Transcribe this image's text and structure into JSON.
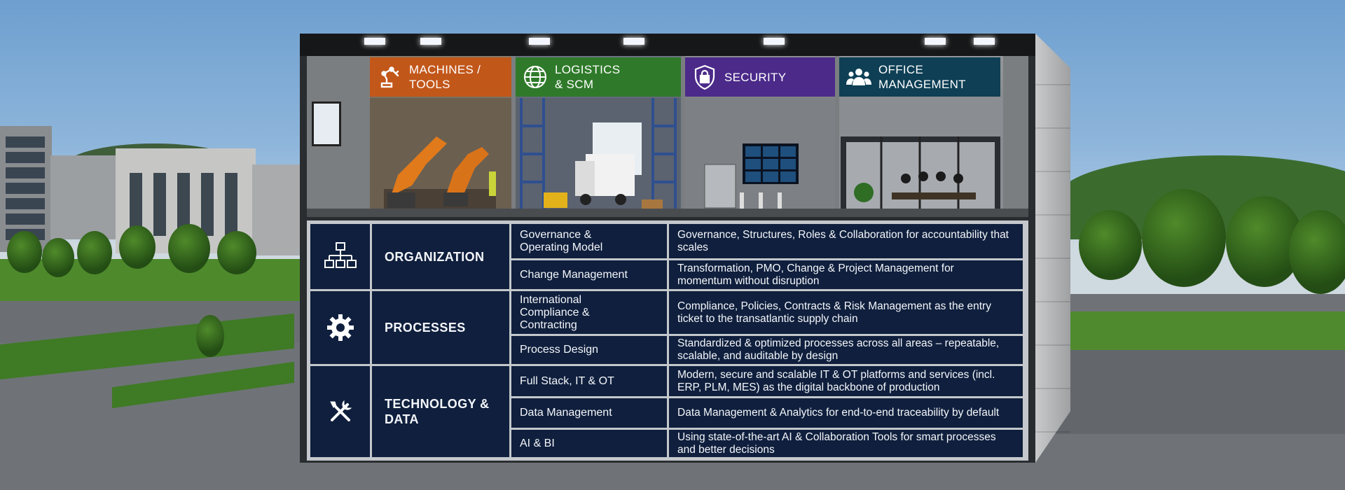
{
  "categories": [
    {
      "label": "MACHINES /\nTOOLS",
      "icon": "robot-arm-icon",
      "color": "#c2571a"
    },
    {
      "label": "LOGISTICS\n& SCM",
      "icon": "globe-icon",
      "color": "#2f7a2a"
    },
    {
      "label": "SECURITY",
      "icon": "shield-lock-icon",
      "color": "#4b2a8a"
    },
    {
      "label": "OFFICE\nMANAGEMENT",
      "icon": "team-icon",
      "color": "#0e3f55"
    }
  ],
  "pillars": [
    {
      "name": "ORGANIZATION",
      "icon": "org-chart-icon",
      "rows": [
        {
          "topic": "Governance &\nOperating Model",
          "description": "Governance, Structures, Roles & Collaboration for accountability that scales"
        },
        {
          "topic": "Change Management",
          "description": "Transformation, PMO, Change & Project Management for momentum without disruption"
        }
      ]
    },
    {
      "name": "PROCESSES",
      "icon": "gear-icon",
      "rows": [
        {
          "topic": "International\nCompliance &\nContracting",
          "description": "Compliance, Policies, Contracts & Risk Management as the entry ticket to the transatlantic supply chain"
        },
        {
          "topic": "Process Design",
          "description": "Standardized & optimized processes across all areas – repeatable, scalable, and auditable by design"
        }
      ]
    },
    {
      "name": "TECHNOLOGY &\nDATA",
      "icon": "tools-icon",
      "rows": [
        {
          "topic": "Full Stack, IT & OT",
          "description": "Modern, secure and scalable IT & OT platforms and services (incl. ERP, PLM, MES) as the digital backbone of production"
        },
        {
          "topic": "Data Management",
          "description": "Data Management & Analytics for end-to-end traceability by default"
        },
        {
          "topic": "AI & BI",
          "description": "Using state-of-the-art AI & Collaboration Tools for smart processes and better decisions"
        }
      ]
    }
  ]
}
